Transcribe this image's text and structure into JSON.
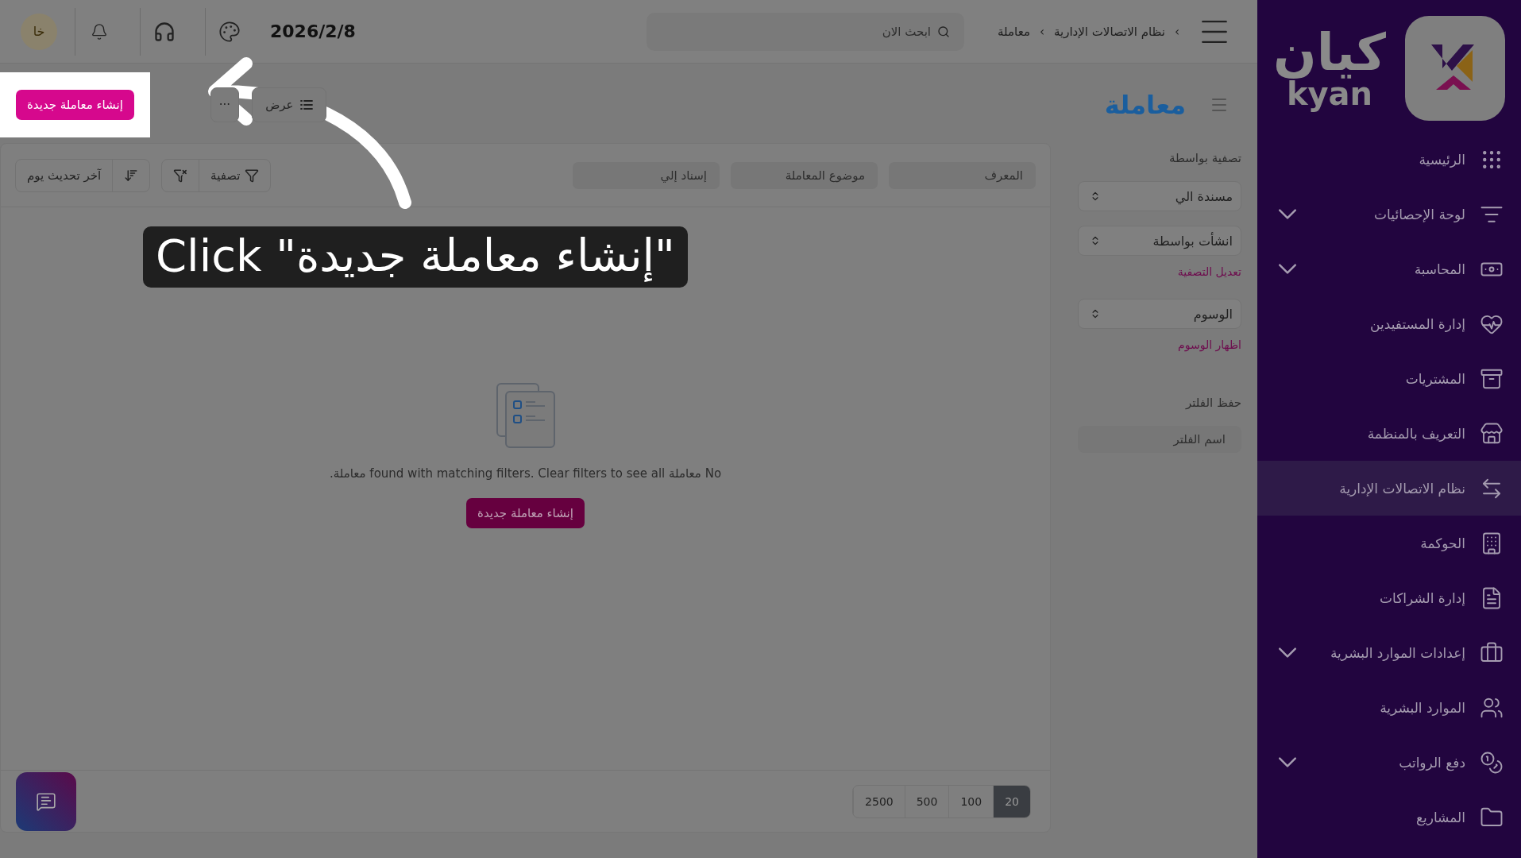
{
  "topbar": {
    "breadcrumb": [
      {
        "label": "›"
      },
      {
        "label": "نظام الاتصالات الإدارية"
      },
      {
        "label": "›"
      },
      {
        "label": "معاملة"
      }
    ],
    "search": {
      "placeholder": "ابحث الان"
    },
    "date": "2026/2/8",
    "avatar": "خا"
  },
  "page": {
    "title": "معاملة",
    "create_button": "إنشاء معاملة جديدة",
    "more_button": "···",
    "view_button": "عرض"
  },
  "filter_panel": {
    "heading": "تصفية بواسطة",
    "selects": [
      {
        "value": "مسندة الي"
      },
      {
        "value": "انشأت بواسطة"
      }
    ],
    "edit_link": "تعديل التصفية",
    "tags_select": {
      "value": "الوسوم"
    },
    "tags_link": "اظهار الوسوم",
    "save_heading": "حفظ الفلتر",
    "name_field": {
      "placeholder": "اسم الفلتر"
    }
  },
  "table": {
    "column_filters": [
      {
        "placeholder": "المعرف"
      },
      {
        "placeholder": "موضوع المعاملة"
      },
      {
        "placeholder": "إسناد إلي"
      }
    ],
    "filter_button": "تصفية",
    "sort_button": "آخر تحديث يوم",
    "empty_message": "No معاملة found with matching filters. Clear filters to see all معاملة.",
    "empty_button": "إنشاء معاملة جديدة",
    "page_sizes": [
      {
        "label": "20",
        "selected": true
      },
      {
        "label": "100",
        "selected": false
      },
      {
        "label": "500",
        "selected": false
      },
      {
        "label": "2500",
        "selected": false
      }
    ]
  },
  "sidebar": {
    "logo_arabic": "كيان",
    "logo_latin": "kyan",
    "items": [
      {
        "label": "الرئيسية",
        "selected": false,
        "has_submenu": false
      },
      {
        "label": "لوحة الإحصائيات",
        "selected": false,
        "has_submenu": true
      },
      {
        "label": "المحاسبة",
        "selected": false,
        "has_submenu": true
      },
      {
        "label": "إدارة المستفيدين",
        "selected": false,
        "has_submenu": false
      },
      {
        "label": "المشتريات",
        "selected": false,
        "has_submenu": false
      },
      {
        "label": "التعريف بالمنظمة",
        "selected": false,
        "has_submenu": false
      },
      {
        "label": "نظام الاتصالات الإدارية",
        "selected": true,
        "has_submenu": false
      },
      {
        "label": "الحوكمة",
        "selected": false,
        "has_submenu": false
      },
      {
        "label": "إدارة الشراكات",
        "selected": false,
        "has_submenu": false
      },
      {
        "label": "إعدادات الموارد البشرية",
        "selected": false,
        "has_submenu": true
      },
      {
        "label": "الموارد البشرية",
        "selected": false,
        "has_submenu": false
      },
      {
        "label": "دفع الرواتب",
        "selected": false,
        "has_submenu": true
      },
      {
        "label": "المشاريع",
        "selected": false,
        "has_submenu": false
      }
    ]
  },
  "tooltip": "Click \"إنشاء معاملة جديدة\""
}
